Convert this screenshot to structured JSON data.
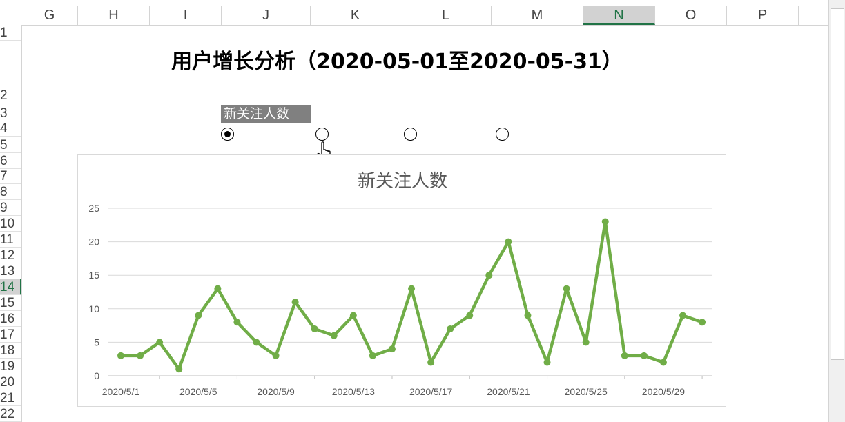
{
  "spreadsheet": {
    "columns": [
      "G",
      "H",
      "I",
      "J",
      "K",
      "L",
      "M",
      "N",
      "O",
      "P"
    ],
    "selected_column": "N",
    "rows": [
      "1",
      "2",
      "3",
      "4",
      "5",
      "6",
      "7",
      "8",
      "9",
      "10",
      "11",
      "12",
      "13",
      "14",
      "15",
      "16",
      "17",
      "18",
      "19",
      "20",
      "21",
      "22"
    ],
    "selected_row": "14"
  },
  "title": "用户增长分析（2020-05-01至2020-05-31）",
  "metric_selector": {
    "label": "新关注人数",
    "options_count": 4,
    "selected_index": 0
  },
  "chart_data": {
    "type": "line",
    "title": "新关注人数",
    "x": [
      "2020/5/1",
      "2020/5/2",
      "2020/5/3",
      "2020/5/4",
      "2020/5/5",
      "2020/5/6",
      "2020/5/7",
      "2020/5/8",
      "2020/5/9",
      "2020/5/10",
      "2020/5/11",
      "2020/5/12",
      "2020/5/13",
      "2020/5/14",
      "2020/5/15",
      "2020/5/16",
      "2020/5/17",
      "2020/5/18",
      "2020/5/19",
      "2020/5/20",
      "2020/5/21",
      "2020/5/22",
      "2020/5/23",
      "2020/5/24",
      "2020/5/25",
      "2020/5/26",
      "2020/5/27",
      "2020/5/28",
      "2020/5/29",
      "2020/5/30",
      "2020/5/31"
    ],
    "x_tick_labels": [
      "2020/5/1",
      "2020/5/5",
      "2020/5/9",
      "2020/5/13",
      "2020/5/17",
      "2020/5/21",
      "2020/5/25",
      "2020/5/29"
    ],
    "series": [
      {
        "values": [
          3,
          3,
          5,
          1,
          9,
          13,
          8,
          5,
          3,
          11,
          7,
          6,
          9,
          3,
          4,
          13,
          2,
          7,
          9,
          15,
          20,
          9,
          2,
          13,
          5,
          23,
          3,
          3,
          2,
          9,
          8
        ]
      }
    ],
    "ylim": [
      0,
      25
    ],
    "y_ticks": [
      0,
      5,
      10,
      15,
      20,
      25
    ],
    "grid": true,
    "color": "#70AD47"
  }
}
